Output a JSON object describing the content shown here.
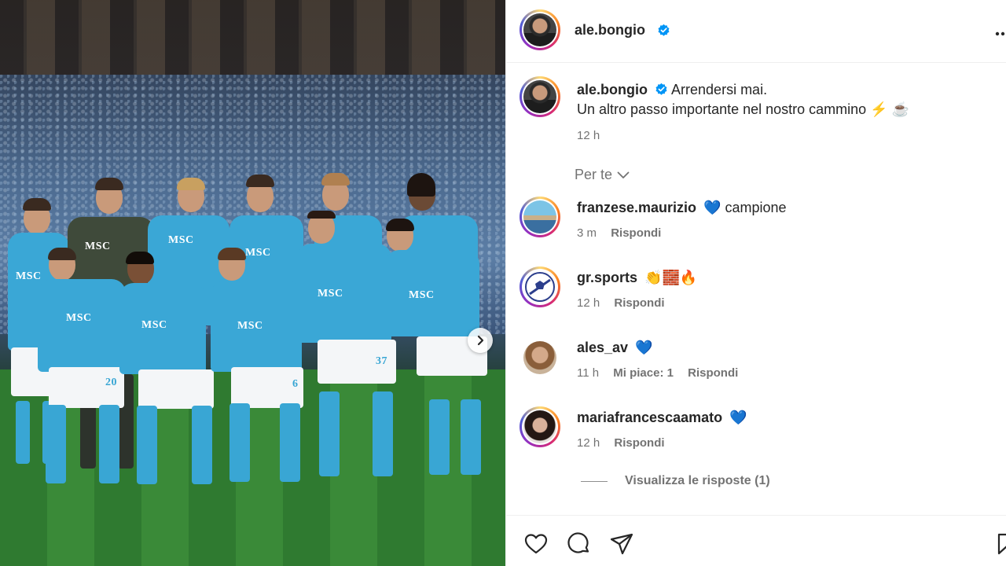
{
  "post": {
    "author": "ale.bongio",
    "caption_line1": "Arrendersi mai.",
    "caption_line2": "Un altro passo importante nel nostro cammino ⚡️ ☕️",
    "time": "12 h",
    "more_icon": "ellipsis-icon",
    "verified_color": "#0095f6"
  },
  "photo": {
    "sponsor": "MSC",
    "numbers": [
      "20",
      "6",
      "37"
    ],
    "next_icon": "chevron-right-icon"
  },
  "per_te": "Per te",
  "comments": [
    {
      "user": "franzese.maurizio",
      "text": "💙 campione",
      "time": "3 m",
      "likes": "",
      "reply": "Rispondi"
    },
    {
      "user": "gr.sports",
      "text": "👏🧱🔥",
      "time": "12 h",
      "likes": "",
      "reply": "Rispondi"
    },
    {
      "user": "ales_av",
      "text": "💙",
      "time": "11 h",
      "likes": "Mi piace: 1",
      "reply": "Rispondi"
    },
    {
      "user": "mariafrancescaamato",
      "text": "💙",
      "time": "12 h",
      "likes": "",
      "reply": "Rispondi"
    }
  ],
  "view_replies": "Visualizza le risposte (1)",
  "actions": {
    "like_icon": "heart-icon",
    "comment_icon": "comment-icon",
    "share_icon": "send-icon",
    "save_icon": "bookmark-icon"
  }
}
